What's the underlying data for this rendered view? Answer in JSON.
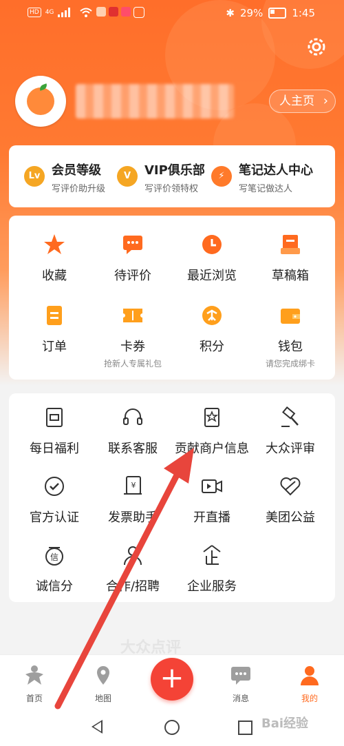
{
  "status_bar": {
    "left_chips": [
      "HD",
      "4G"
    ],
    "bluetooth": "✱",
    "battery_pct": "29%",
    "time": "1:45"
  },
  "profile": {
    "homepage_label": "人主页",
    "homepage_chevron": "›"
  },
  "member_section": [
    {
      "icon": "level-icon",
      "icon_text": "Lv",
      "title": "会员等级",
      "subtitle": "写评价助升级",
      "color": "#f5a623"
    },
    {
      "icon": "vip-icon",
      "icon_text": "V",
      "title": "VIP俱乐部",
      "subtitle": "写评价领特权",
      "color": "#f5a623"
    },
    {
      "icon": "bulb-icon",
      "icon_text": "⚡",
      "title": "笔记达人中心",
      "subtitle": "写笔记做达人",
      "color": "#ff7a2a"
    }
  ],
  "main_grid": [
    {
      "label": "收藏",
      "sub": "",
      "icon": "star-icon"
    },
    {
      "label": "待评价",
      "sub": "",
      "icon": "comment-icon"
    },
    {
      "label": "最近浏览",
      "sub": "",
      "icon": "clock-icon"
    },
    {
      "label": "草稿箱",
      "sub": "",
      "icon": "draft-icon"
    },
    {
      "label": "订单",
      "sub": "",
      "icon": "order-icon"
    },
    {
      "label": "卡券",
      "sub": "抢新人专属礼包",
      "icon": "coupon-icon"
    },
    {
      "label": "积分",
      "sub": "",
      "icon": "points-icon"
    },
    {
      "label": "钱包",
      "sub": "请您完成绑卡",
      "icon": "wallet-icon"
    }
  ],
  "service_grid": [
    {
      "label": "每日福利",
      "icon": "gift-icon"
    },
    {
      "label": "联系客服",
      "icon": "headset-icon"
    },
    {
      "label": "贡献商户信息",
      "icon": "store-badge-icon"
    },
    {
      "label": "大众评审",
      "icon": "gavel-icon"
    },
    {
      "label": "官方认证",
      "icon": "check-circle-icon"
    },
    {
      "label": "发票助手",
      "icon": "invoice-icon"
    },
    {
      "label": "开直播",
      "icon": "video-icon"
    },
    {
      "label": "美团公益",
      "icon": "heart-icon"
    },
    {
      "label": "诚信分",
      "icon": "credit-icon"
    },
    {
      "label": "合作/招聘",
      "icon": "person-icon"
    },
    {
      "label": "企业服务",
      "icon": "enterprise-icon"
    }
  ],
  "tab_bar": [
    {
      "label": "首页",
      "icon": "home-icon",
      "active": false
    },
    {
      "label": "地图",
      "icon": "map-icon",
      "active": false
    },
    {
      "label": "消息",
      "icon": "message-icon",
      "active": false
    },
    {
      "label": "我的",
      "icon": "profile-icon",
      "active": true
    }
  ],
  "plus_button": "+",
  "watermark": "大众点评",
  "baidu_watermark": "Bai经验",
  "colors": {
    "brand": "#ff6e2a",
    "accent": "#ff6a1f",
    "plus": "#f44336",
    "arrow": "#e8453c"
  }
}
